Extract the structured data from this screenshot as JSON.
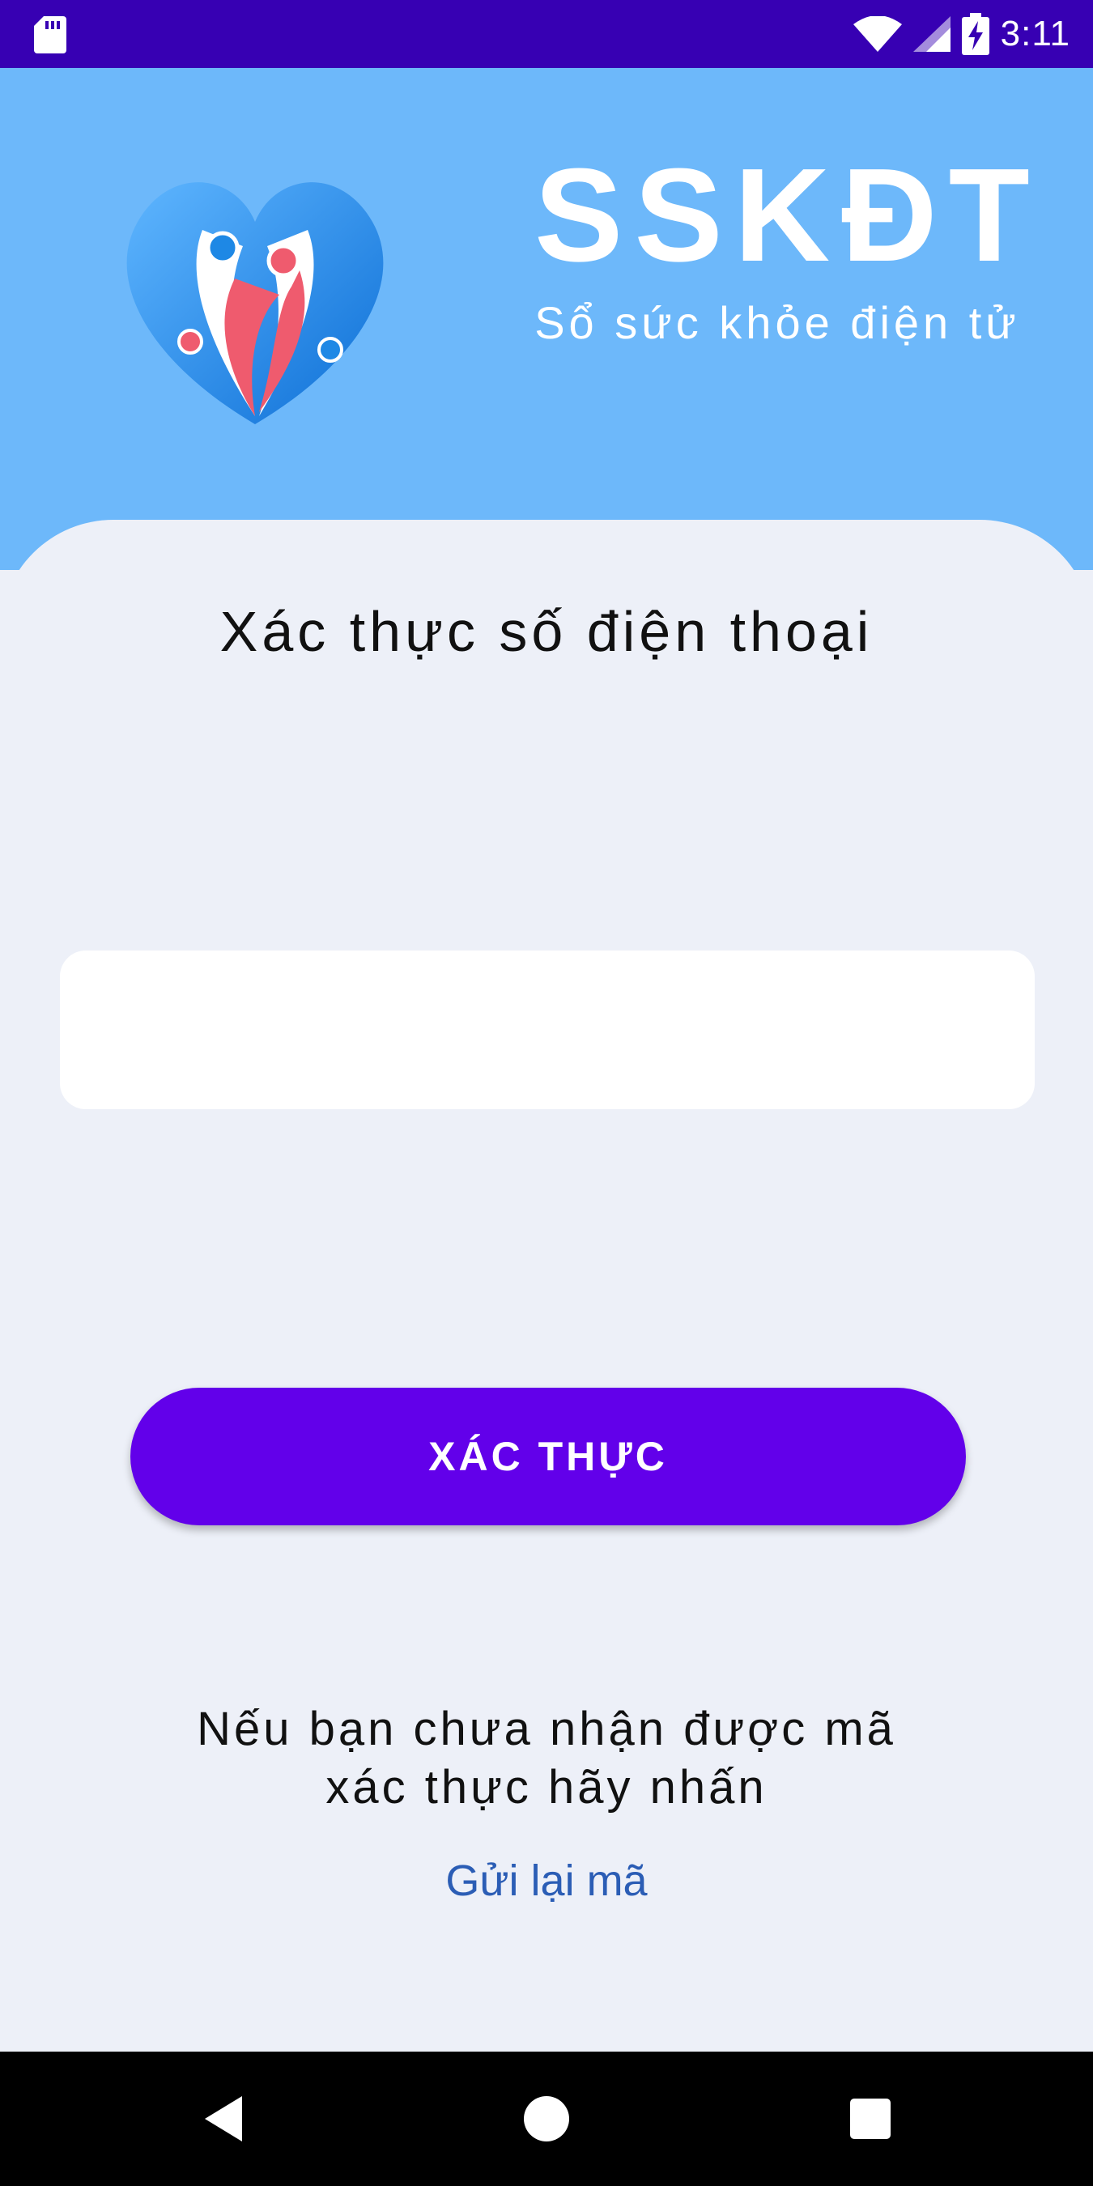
{
  "status_bar": {
    "time": "3:11",
    "icons": [
      "sd-card-icon",
      "wifi-icon",
      "signal-icon",
      "battery-charging-icon"
    ]
  },
  "header": {
    "app_name": "SSKĐT",
    "app_subtitle": "Sổ sức khỏe điện tử",
    "logo_icon": "heart-family-logo",
    "colors": {
      "background": "#6db8fa",
      "logo_blue": "#1e88e5",
      "logo_red": "#ef5b6e"
    }
  },
  "main": {
    "title": "Xác thực số điện thoại",
    "code_input": {
      "value": "",
      "placeholder": ""
    },
    "verify_button_label": "XÁC THỰC",
    "notice_line1": "Nếu bạn chưa nhận được mã",
    "notice_line2": "xác thực hãy nhấn",
    "resend_link": "Gửi lại mã",
    "colors": {
      "button": "#6200ea",
      "link": "#2b5db5",
      "background": "#edf0f8"
    }
  },
  "nav_bar": {
    "buttons": [
      "back-icon",
      "home-icon",
      "recents-icon"
    ]
  }
}
